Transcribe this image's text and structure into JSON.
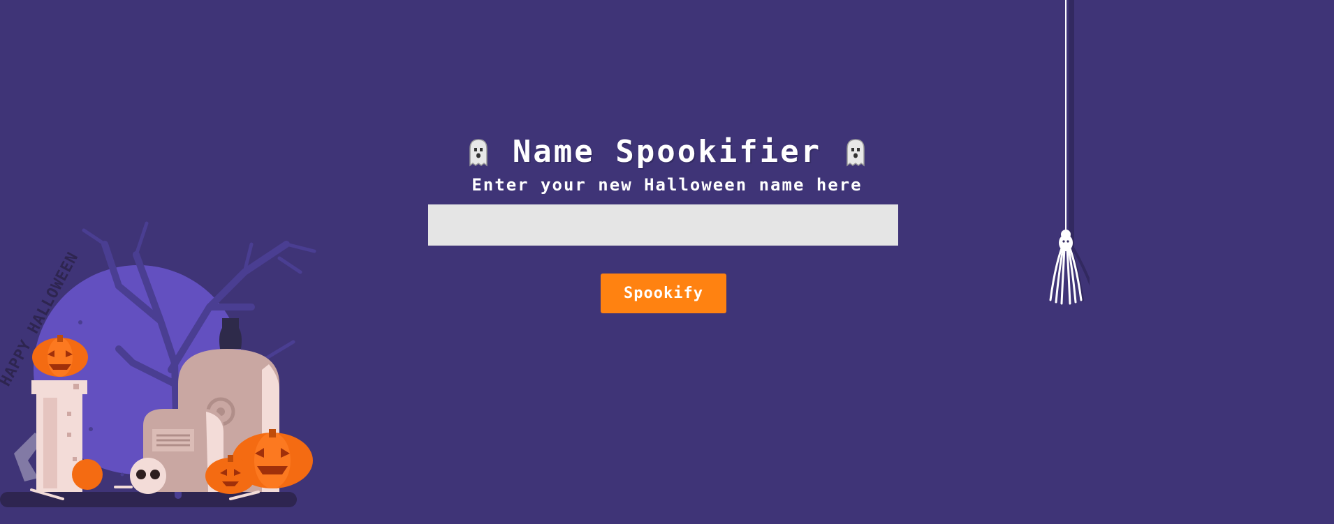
{
  "header": {
    "title": "Name Spookifier",
    "left_icon": "ghost-icon",
    "right_icon": "ghost-icon"
  },
  "form": {
    "subtitle": "Enter your new Halloween name here",
    "input_value": "",
    "input_placeholder": "",
    "button_label": "Spookify"
  },
  "decor": {
    "scene_icon": "graveyard-illustration",
    "spider_icon": "spider-icon",
    "banner_text": "HAPPY HALLOWEEN"
  },
  "colors": {
    "background": "#3f3477",
    "button": "#ff8211",
    "input_background": "#e5e5e5",
    "moon": "#6350c0",
    "pumpkin": "#f46b12"
  }
}
